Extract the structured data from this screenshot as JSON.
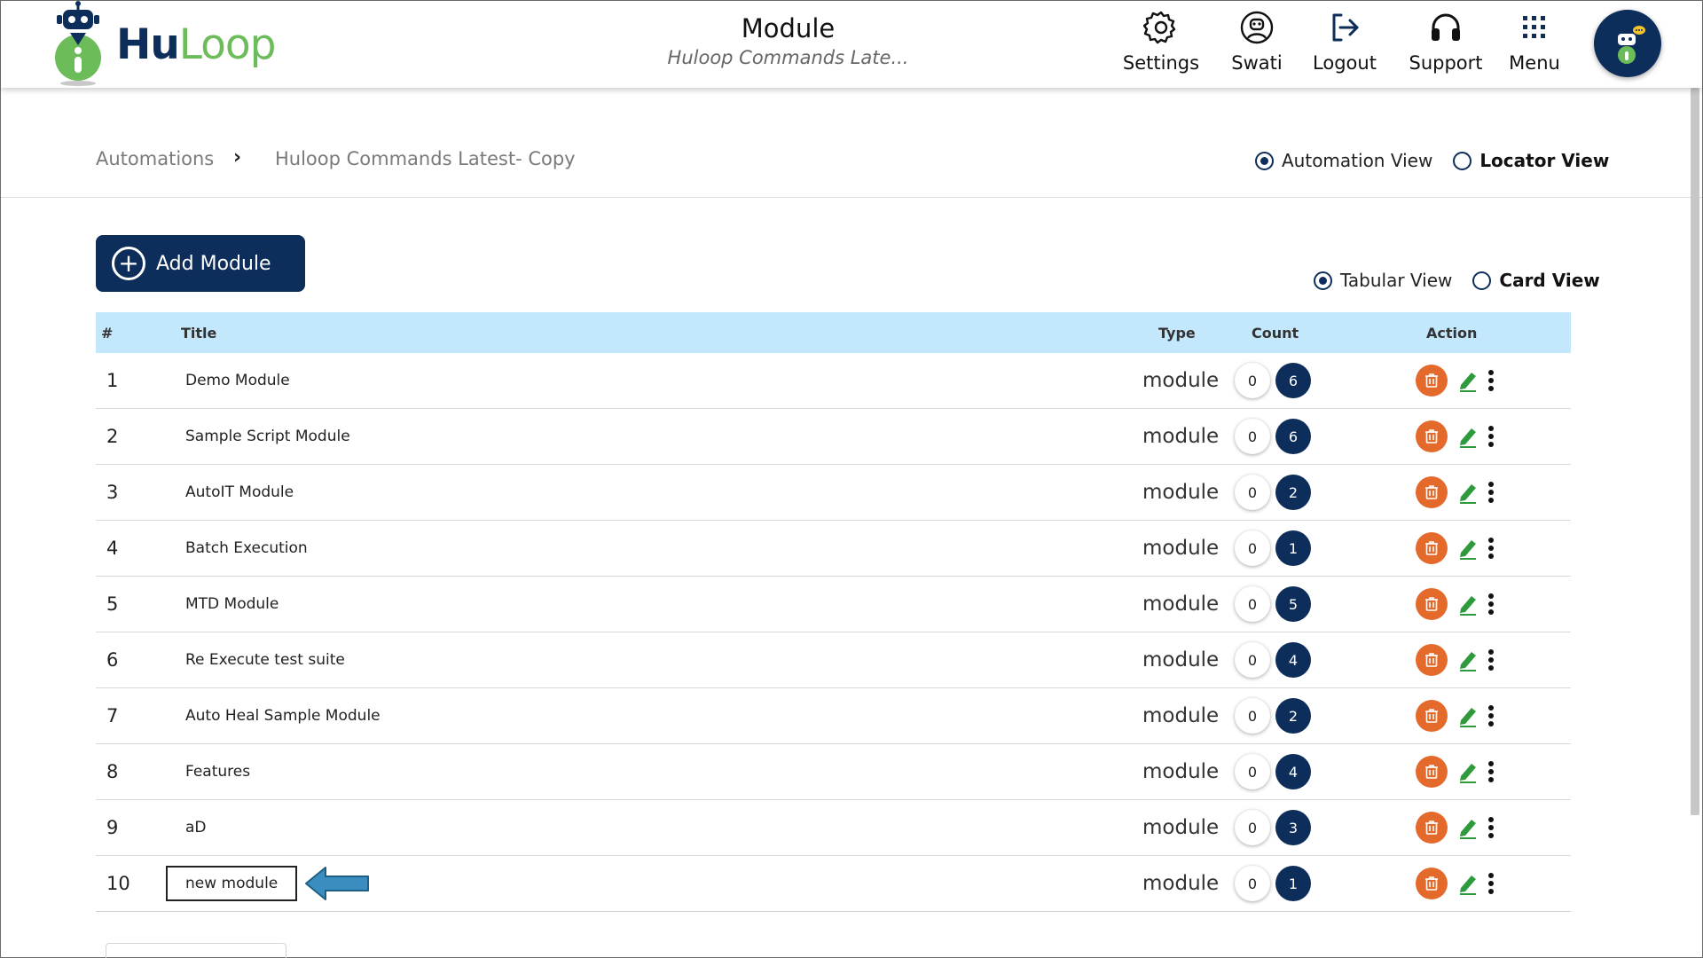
{
  "app": {
    "brand_hu": "Hu",
    "brand_loop": "Loop",
    "page_title": "Module",
    "page_subtitle": "Huloop Commands Late..."
  },
  "nav": {
    "settings": "Settings",
    "user": "Swati",
    "logout": "Logout",
    "support": "Support",
    "menu": "Menu"
  },
  "breadcrumb": {
    "root": "Automations",
    "separator": "›",
    "current": "Huloop Commands Latest- Copy"
  },
  "view_toggle": {
    "automation": "Automation View",
    "locator": "Locator View",
    "selected": "automation"
  },
  "layout_toggle": {
    "tabular": "Tabular View",
    "card": "Card View",
    "selected": "tabular"
  },
  "add_button": "Add Module",
  "table": {
    "headers": {
      "num": "#",
      "title": "Title",
      "type": "Type",
      "count": "Count",
      "action": "Action"
    },
    "rows": [
      {
        "num": "1",
        "title": "Demo Module",
        "type": "module",
        "count_a": "0",
        "count_b": "6"
      },
      {
        "num": "2",
        "title": "Sample Script Module",
        "type": "module",
        "count_a": "0",
        "count_b": "6"
      },
      {
        "num": "3",
        "title": "AutoIT Module",
        "type": "module",
        "count_a": "0",
        "count_b": "2"
      },
      {
        "num": "4",
        "title": "Batch Execution",
        "type": "module",
        "count_a": "0",
        "count_b": "1"
      },
      {
        "num": "5",
        "title": "MTD Module",
        "type": "module",
        "count_a": "0",
        "count_b": "5"
      },
      {
        "num": "6",
        "title": "Re Execute test suite",
        "type": "module",
        "count_a": "0",
        "count_b": "4"
      },
      {
        "num": "7",
        "title": "Auto Heal Sample Module",
        "type": "module",
        "count_a": "0",
        "count_b": "2"
      },
      {
        "num": "8",
        "title": "Features",
        "type": "module",
        "count_a": "0",
        "count_b": "4"
      },
      {
        "num": "9",
        "title": "aD",
        "type": "module",
        "count_a": "0",
        "count_b": "3"
      },
      {
        "num": "10",
        "title": "new module",
        "type": "module",
        "count_a": "0",
        "count_b": "1"
      }
    ]
  },
  "colors": {
    "brand_navy": "#0d2d5a",
    "brand_green": "#6cbd5a",
    "header_row_bg": "#c3e7fb",
    "delete_orange": "#e36a2b",
    "edit_green": "#2e9a3c",
    "annotation_arrow": "#3a8ebf"
  },
  "icons": {
    "settings": "gear-icon",
    "user": "user-circle-icon",
    "logout": "logout-icon",
    "support": "headset-icon",
    "menu": "grid-icon",
    "delete": "trash-icon",
    "edit": "pencil-icon",
    "more": "kebab-icon"
  }
}
